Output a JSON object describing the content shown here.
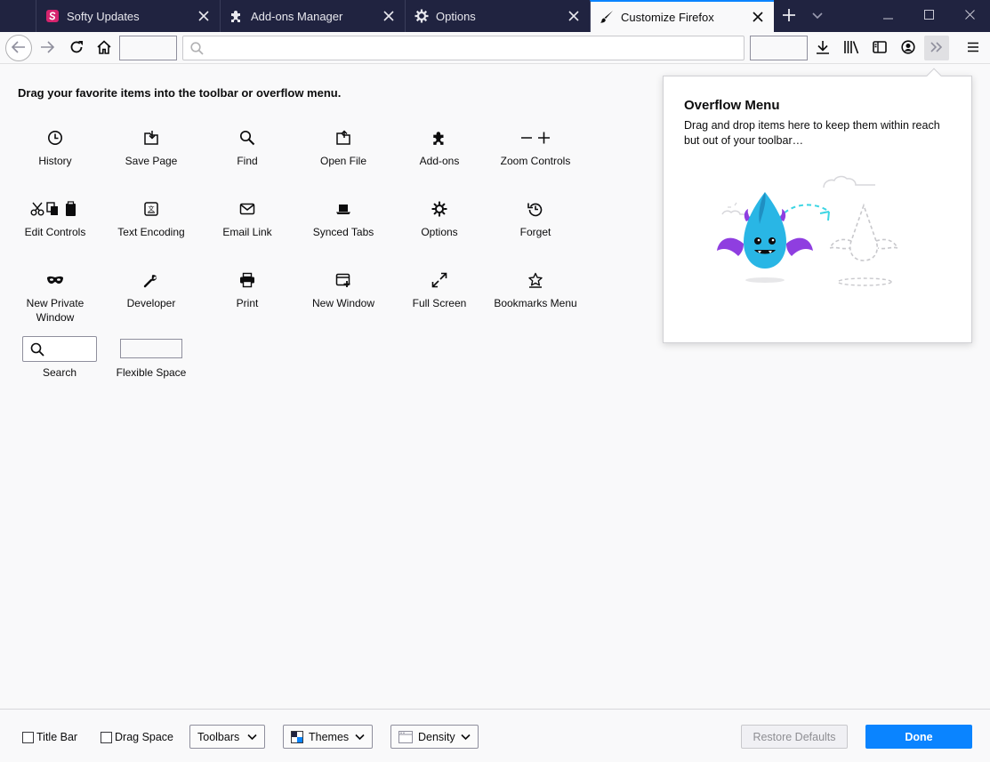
{
  "window": {
    "tabs": [
      {
        "label": "Softy Updates",
        "icon": "softy-logo-icon",
        "active": false
      },
      {
        "label": "Add-ons Manager",
        "icon": "puzzle-icon",
        "active": false
      },
      {
        "label": "Options",
        "icon": "gear-icon",
        "active": false
      },
      {
        "label": "Customize Firefox",
        "icon": "paintbrush-icon",
        "active": true
      }
    ],
    "new_tab_icon": "plus-icon",
    "tab_list_icon": "chevron-down-icon",
    "controls": [
      "minimize-icon",
      "maximize-icon",
      "close-icon"
    ]
  },
  "toolbar": {
    "urlbar_placeholder": "",
    "icons": [
      "back-arrow-icon",
      "forward-arrow-icon",
      "reload-icon",
      "home-icon",
      "download-icon",
      "library-icon",
      "sidebar-icon",
      "account-icon",
      "overflow-chevrons-icon",
      "menu-icon"
    ]
  },
  "palette": {
    "title": "Drag your favorite items into the toolbar or overflow menu.",
    "items": [
      {
        "label": "History",
        "icon": "clock-icon"
      },
      {
        "label": "Save Page",
        "icon": "save-page-icon"
      },
      {
        "label": "Find",
        "icon": "magnifier-icon"
      },
      {
        "label": "Open File",
        "icon": "open-file-icon"
      },
      {
        "label": "Add-ons",
        "icon": "puzzle-icon"
      },
      {
        "label": "Zoom Controls",
        "icon": "zoom-icon"
      },
      {
        "label": "Edit Controls",
        "icon": "edit-controls-icon"
      },
      {
        "label": "Text Encoding",
        "icon": "text-encoding-icon"
      },
      {
        "label": "Email Link",
        "icon": "envelope-icon"
      },
      {
        "label": "Synced Tabs",
        "icon": "laptop-icon"
      },
      {
        "label": "Options",
        "icon": "gear-icon"
      },
      {
        "label": "Forget",
        "icon": "forget-icon"
      },
      {
        "label": "New Private Window",
        "icon": "mask-icon"
      },
      {
        "label": "Developer",
        "icon": "wrench-icon"
      },
      {
        "label": "Print",
        "icon": "printer-icon"
      },
      {
        "label": "New Window",
        "icon": "new-window-icon"
      },
      {
        "label": "Full Screen",
        "icon": "fullscreen-icon"
      },
      {
        "label": "Bookmarks Menu",
        "icon": "star-menu-icon"
      },
      {
        "label": "Search",
        "icon": "search-widget"
      },
      {
        "label": "Flexible Space",
        "icon": "flexible-space-widget"
      }
    ]
  },
  "overflow_panel": {
    "title": "Overflow Menu",
    "description": "Drag and drop items here to keep them within reach but out of your toolbar…",
    "illustration": "dragon-mascot-illustration"
  },
  "footer": {
    "title_bar": "Title Bar",
    "drag_space": "Drag Space",
    "toolbars": "Toolbars",
    "themes": "Themes",
    "density": "Density",
    "restore_defaults": "Restore Defaults",
    "done": "Done"
  },
  "colors": {
    "tabstrip_bg": "#202340",
    "accent": "#0a84ff",
    "page_bg": "#f9f9fa",
    "softy_brand": "#d6246e",
    "dragon_body": "#29b6e5",
    "dragon_wings": "#8f3ee0"
  }
}
